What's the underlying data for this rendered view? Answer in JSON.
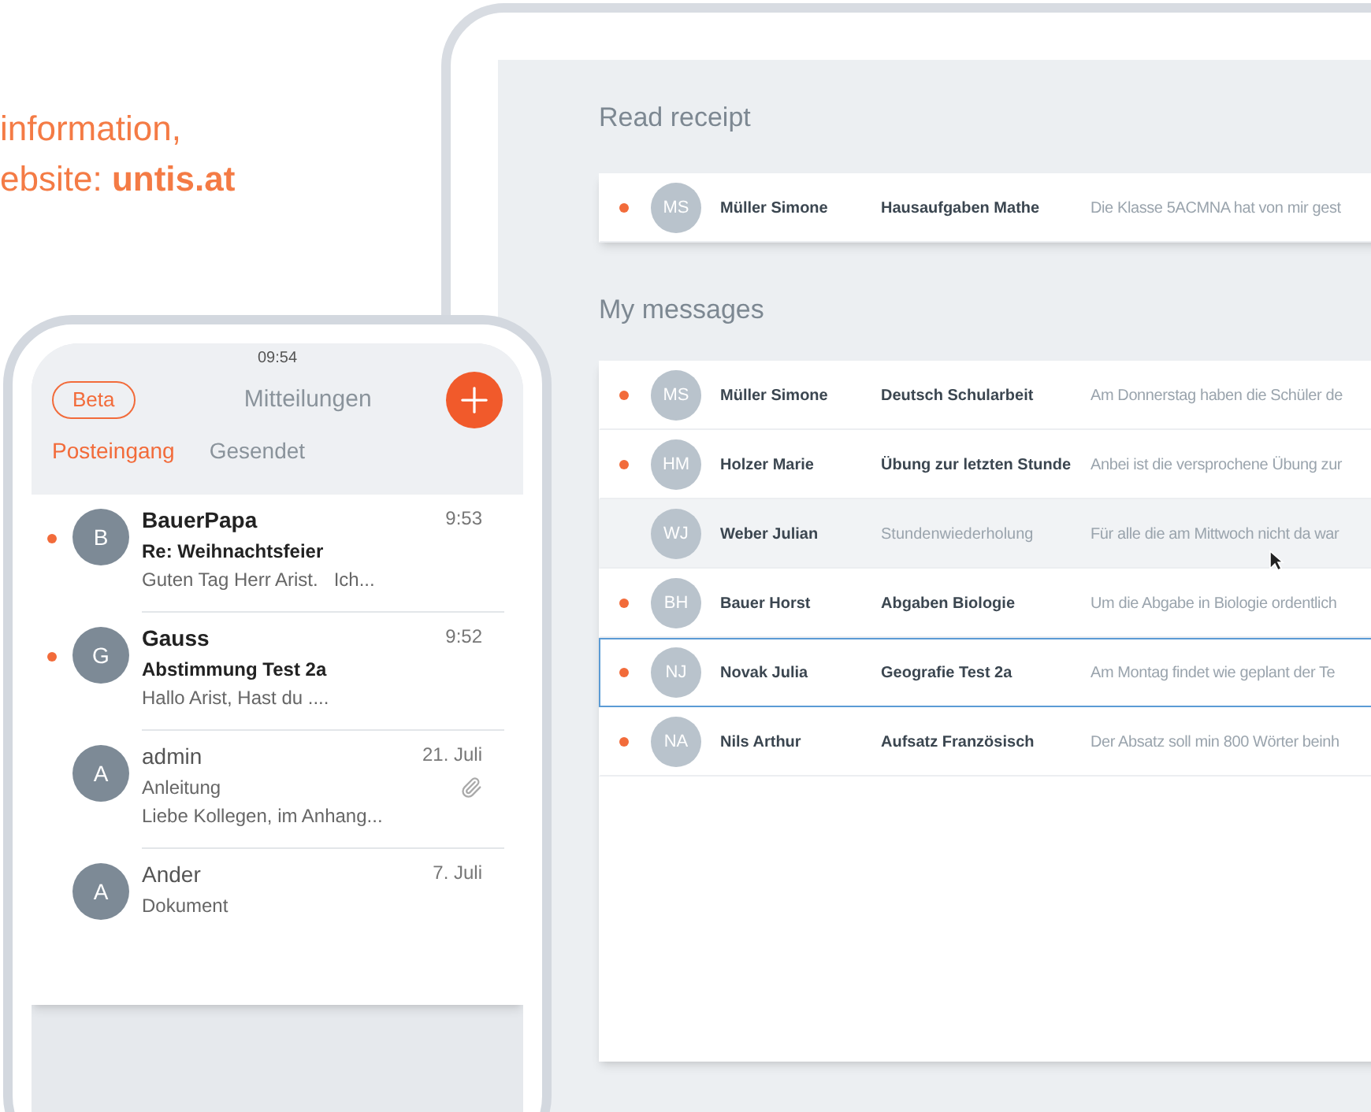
{
  "headline": {
    "lines": [
      "information,",
      "ebsite: **untis.at**"
    ]
  },
  "tablet": {
    "sections": [
      {
        "title": "Read receipt",
        "rows": [
          {
            "unread": true,
            "hovered": false,
            "selected": false,
            "initials": "MS",
            "sender": "Müller Simone",
            "subject": "Hausaufgaben Mathe",
            "preview": "Die Klasse 5ACMNA hat von mir gest"
          }
        ]
      },
      {
        "title": "My messages",
        "rows": [
          {
            "unread": true,
            "hovered": false,
            "selected": false,
            "initials": "MS",
            "sender": "Müller Simone",
            "subject": "Deutsch Schularbeit",
            "preview": "Am Donnerstag haben die Schüler de"
          },
          {
            "unread": true,
            "hovered": false,
            "selected": false,
            "initials": "HM",
            "sender": "Holzer Marie",
            "subject": "Übung zur letzten Stunde",
            "preview": "Anbei ist die versprochene Übung zur"
          },
          {
            "unread": false,
            "hovered": true,
            "selected": false,
            "initials": "WJ",
            "sender": "Weber Julian",
            "subject": "Stundenwiederholung",
            "preview": "Für alle die am Mittwoch nicht da war"
          },
          {
            "unread": true,
            "hovered": false,
            "selected": false,
            "initials": "BH",
            "sender": "Bauer Horst",
            "subject": "Abgaben Biologie",
            "preview": "Um die Abgabe in Biologie ordentlich"
          },
          {
            "unread": true,
            "hovered": false,
            "selected": true,
            "initials": "NJ",
            "sender": "Novak Julia",
            "subject": "Geografie Test 2a",
            "preview": "Am Montag findet wie geplant der Te"
          },
          {
            "unread": true,
            "hovered": false,
            "selected": false,
            "initials": "NA",
            "sender": "Nils Arthur",
            "subject": "Aufsatz Französisch",
            "preview": "Der Absatz soll min 800 Wörter beinh"
          }
        ]
      }
    ]
  },
  "phone": {
    "time": "09:54",
    "badge": "Beta",
    "title": "Mitteilungen",
    "tabs": [
      {
        "label": "Posteingang",
        "selected": true
      },
      {
        "label": "Gesendet",
        "selected": false
      }
    ],
    "messages": [
      {
        "unread": true,
        "initial": "B",
        "sender": "BauerPapa",
        "time": "9:53",
        "subject": "Re: Weihnachtsfeier",
        "preview": "Guten Tag Herr Arist.   Ich...",
        "attachment": false
      },
      {
        "unread": true,
        "initial": "G",
        "sender": "Gauss",
        "time": "9:52",
        "subject": "Abstimmung Test 2a",
        "preview": "Hallo Arist, Hast du ....",
        "attachment": false
      },
      {
        "unread": false,
        "initial": "A",
        "sender": "admin",
        "time": "21. Juli",
        "subject": "Anleitung",
        "preview": "Liebe Kollegen, im Anhang...",
        "attachment": true
      },
      {
        "unread": false,
        "initial": "A",
        "sender": "Ander",
        "time": "7. Juli",
        "subject": "Dokument",
        "attachment": false
      }
    ]
  }
}
